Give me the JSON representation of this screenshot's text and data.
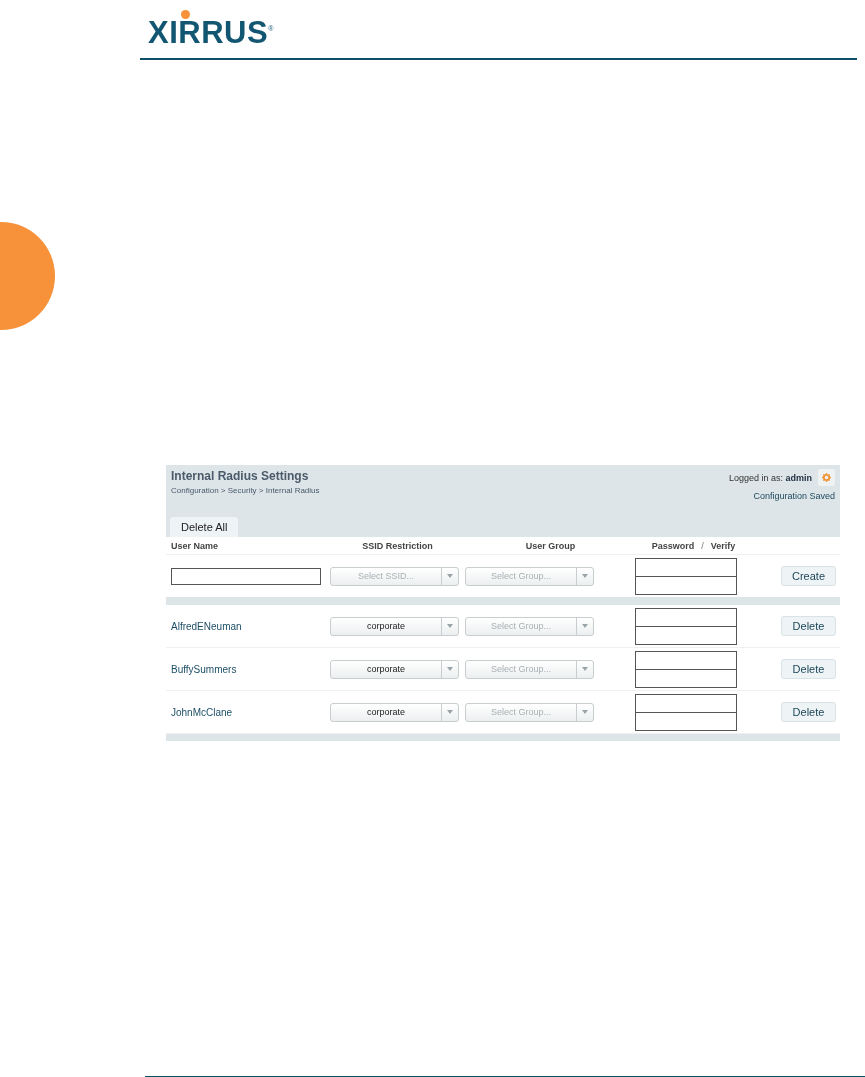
{
  "logo": {
    "name": "XIRRUS",
    "mark": "®"
  },
  "panel": {
    "title": "Internal Radius Settings",
    "breadcrumb": "Configuration > Security > Internal Radius",
    "login_label": "Logged in as:",
    "login_user": "admin",
    "status": "Configuration Saved",
    "delete_all": "Delete All"
  },
  "columns": {
    "user_name": "User Name",
    "ssid": "SSID Restriction",
    "group": "User Group",
    "password": "Password",
    "separator": "/",
    "verify": "Verify"
  },
  "new_user": {
    "ssid": {
      "placeholder": "Select SSID..."
    },
    "group": {
      "placeholder": "Select Group..."
    },
    "button": "Create"
  },
  "users": [
    {
      "name": "AlfredENeuman",
      "ssid": {
        "value": "corporate"
      },
      "group": {
        "placeholder": "Select Group..."
      },
      "button": "Delete"
    },
    {
      "name": "BuffySummers",
      "ssid": {
        "value": "corporate"
      },
      "group": {
        "placeholder": "Select Group..."
      },
      "button": "Delete"
    },
    {
      "name": "JohnMcClane",
      "ssid": {
        "value": "corporate"
      },
      "group": {
        "placeholder": "Select Group..."
      },
      "button": "Delete"
    }
  ]
}
